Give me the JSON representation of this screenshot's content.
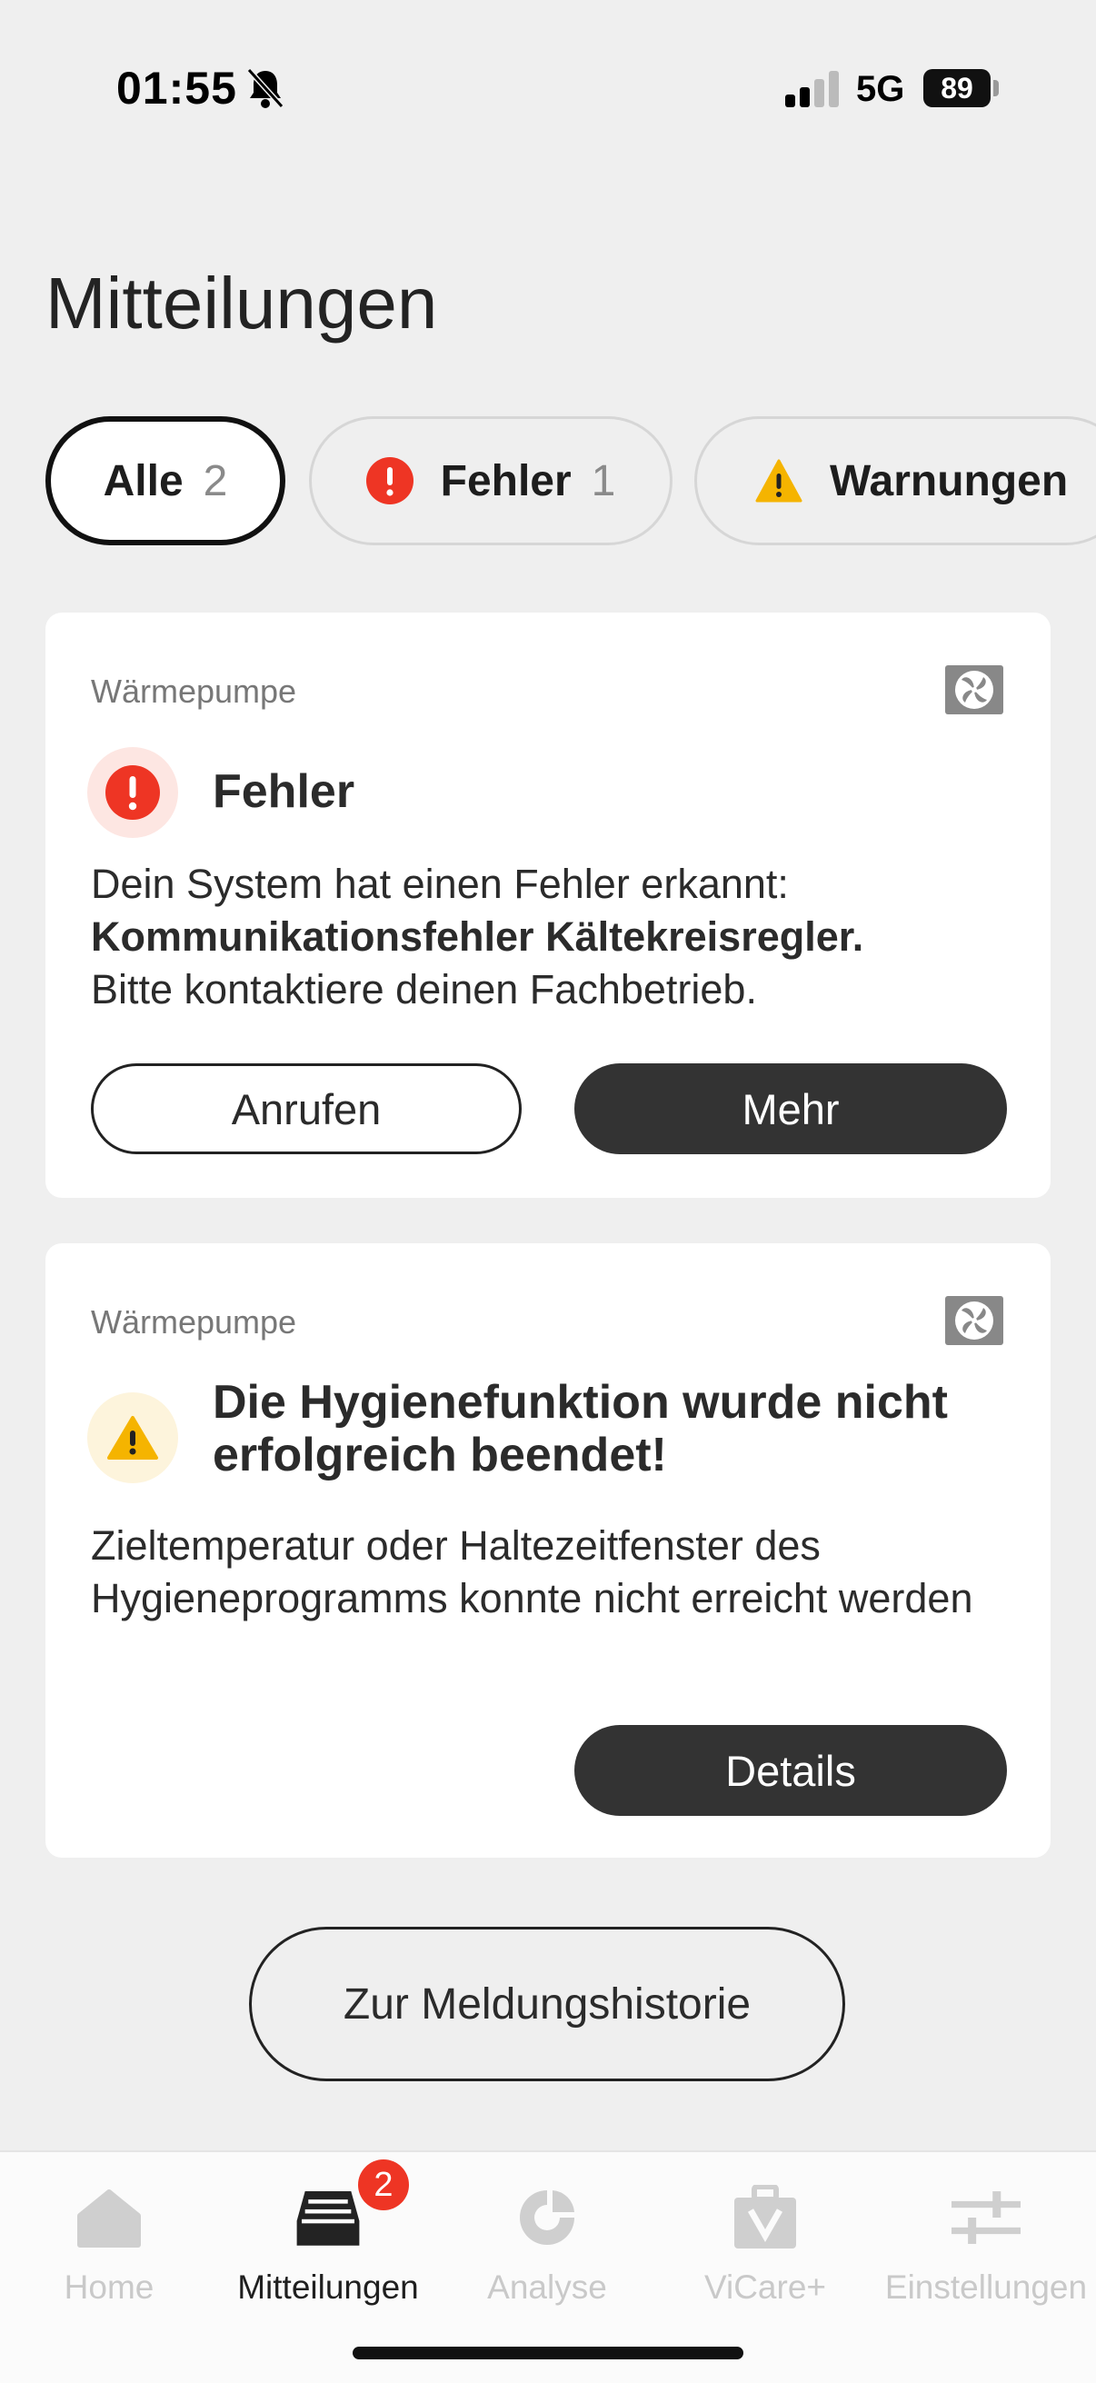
{
  "status_bar": {
    "time": "01:55",
    "network": "5G",
    "battery": "89"
  },
  "page": {
    "title": "Mitteilungen"
  },
  "filters": [
    {
      "label": "Alle",
      "count": "2",
      "active": true
    },
    {
      "label": "Fehler",
      "count": "1",
      "icon": "error-icon"
    },
    {
      "label": "Warnungen",
      "icon": "warning-icon"
    }
  ],
  "cards": [
    {
      "device": "Wärmepumpe",
      "device_icon": "heat-pump-fan-icon",
      "status_icon": "error-icon",
      "title": "Fehler",
      "body_intro": "Dein System hat einen Fehler erkannt:",
      "body_bold": "Kommunikationsfehler Kältekreisregler.",
      "body_outro": "Bitte kontaktiere deinen Fachbetrieb.",
      "secondary_button": "Anrufen",
      "primary_button": "Mehr"
    },
    {
      "device": "Wärmepumpe",
      "device_icon": "heat-pump-fan-icon",
      "status_icon": "warning-icon",
      "title": "Die Hygienefunktion wurde nicht erfolgreich beendet!",
      "body": "Zieltemperatur oder Haltezeitfenster des Hygieneprogramms konnte nicht erreicht werden",
      "primary_button": "Details"
    }
  ],
  "history_button": "Zur Meldungshistorie",
  "tab_bar": {
    "items": [
      {
        "label": "Home",
        "icon": "home-icon"
      },
      {
        "label": "Mitteilungen",
        "icon": "inbox-icon",
        "active": true,
        "badge": "2"
      },
      {
        "label": "Analyse",
        "icon": "analyse-icon"
      },
      {
        "label": "ViCare+",
        "icon": "vicare-plus-icon"
      },
      {
        "label": "Einstellungen",
        "icon": "sliders-icon"
      }
    ]
  },
  "colors": {
    "error": "#ee3524",
    "warning": "#f5b400",
    "dark_button": "#333333",
    "background": "#efefef"
  }
}
